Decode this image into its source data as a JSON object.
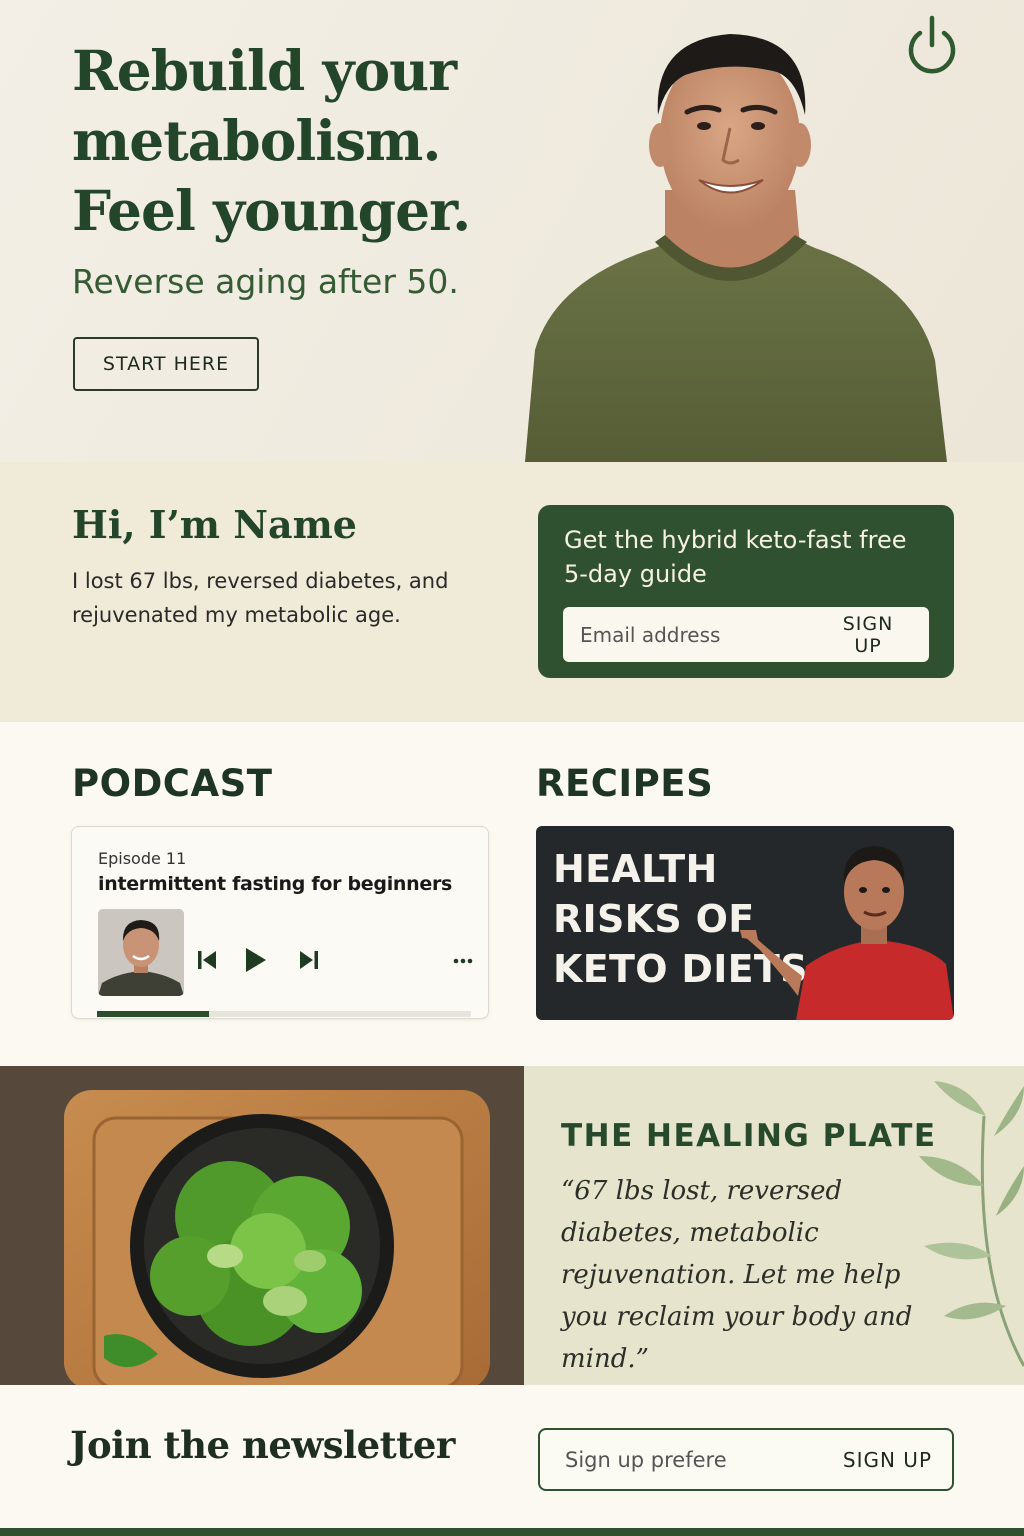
{
  "hero": {
    "title_line1": "Rebuild your",
    "title_line2": "metabolism.",
    "title_line3": "Feel younger.",
    "subtitle": "Reverse aging after 50.",
    "cta_label": "START HERE",
    "power_icon": "power-icon"
  },
  "intro": {
    "greeting": "Hi, I’m Name",
    "bio": "I lost 67 lbs, reversed diabetes, and rejuvenated my metabolic age.",
    "guide": {
      "title": "Get the hybrid keto-fast free 5-day guide",
      "email_placeholder": "Email address",
      "button_label": "SIGN UP"
    }
  },
  "podcast": {
    "heading": "PODCAST",
    "episode_number": "Episode 11",
    "episode_title": "intermittent fasting  for beginners",
    "progress": 0.3,
    "controls": [
      "skip-back-icon",
      "play-icon",
      "skip-forward-icon",
      "more-icon"
    ]
  },
  "recipes": {
    "heading": "RECIPES",
    "video_title": "HEALTH RISKS OF KETO DIETS"
  },
  "healing_plate": {
    "title": "THE HEALING PLATE",
    "quote": "“67 lbs lost, reversed diabetes, metabolic rejuvenation. Let me help you reclaim your body and mind.”"
  },
  "newsletter": {
    "title": "Join the newsletter",
    "placeholder": "Sign up prefere",
    "button_label": "SIGN UP"
  },
  "colors": {
    "brand_green": "#2f5130",
    "heading_green": "#23452a",
    "cream": "#fbf9f1",
    "beige": "#f0ead8"
  }
}
